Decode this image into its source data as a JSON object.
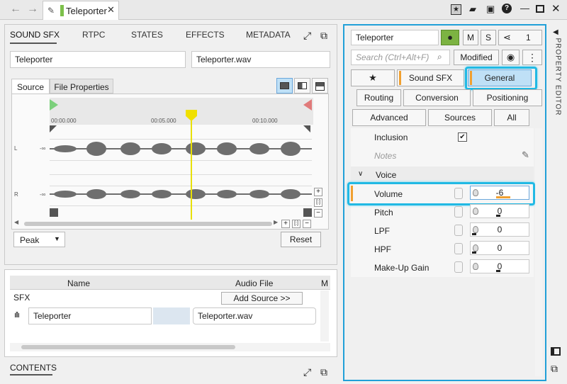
{
  "topbar": {
    "tab_title": "Teleporter"
  },
  "left": {
    "tabs": [
      "SOUND SFX",
      "RTPC",
      "STATES",
      "EFFECTS",
      "METADATA"
    ],
    "name_field": "Teleporter",
    "file_field": "Teleporter.wav",
    "subtabs": [
      "Source",
      "File Properties"
    ],
    "timeline": [
      "00:00.000",
      "00:05.000",
      "00:10.000"
    ],
    "channels": {
      "left": "L",
      "right": "R",
      "db": "-∞"
    },
    "meter_select": "Peak",
    "reset_label": "Reset"
  },
  "sources": {
    "col_name": "Name",
    "col_audio": "Audio File",
    "col_more": "M",
    "group": "SFX",
    "add_source": "Add Source >>",
    "row_name": "Teleporter",
    "row_file": "Teleporter.wav"
  },
  "contents": {
    "title": "CONTENTS"
  },
  "property_editor": {
    "side_title": "PROPERTY EDITOR",
    "object_name": "Teleporter",
    "m_label": "M",
    "s_label": "S",
    "share_count": "1",
    "search_placeholder": "Search (Ctrl+Alt+F)",
    "modified_label": "Modified",
    "tabs": {
      "star": "★",
      "sound_sfx": "Sound SFX",
      "general": "General",
      "routing": "Routing",
      "conversion": "Conversion",
      "positioning": "Positioning",
      "advanced": "Advanced",
      "sources": "Sources",
      "all": "All"
    },
    "inclusion_label": "Inclusion",
    "inclusion_checked": "✔",
    "notes_placeholder": "Notes",
    "voice_group": "Voice",
    "props": [
      {
        "label": "Volume",
        "value": "-6"
      },
      {
        "label": "Pitch",
        "value": "0"
      },
      {
        "label": "LPF",
        "value": "0"
      },
      {
        "label": "HPF",
        "value": "0"
      },
      {
        "label": "Make-Up Gain",
        "value": "0"
      }
    ],
    "accent": "#f0a030",
    "highlight": "#21b9e4"
  }
}
